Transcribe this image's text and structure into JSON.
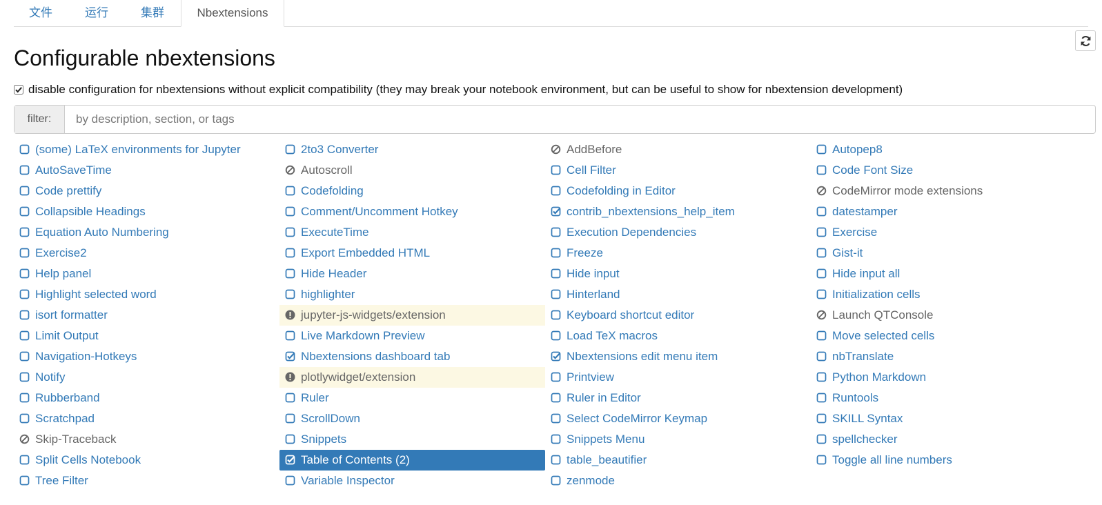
{
  "tabs": [
    "文件",
    "运行",
    "集群",
    "Nbextensions"
  ],
  "active_tab": 3,
  "page_title": "Configurable nbextensions",
  "compat_label": "disable configuration for nbextensions without explicit compatibility (they may break your notebook environment, but can be useful to show for nbextension development)",
  "compat_checked": true,
  "filter": {
    "label": "filter:",
    "placeholder": "by description, section, or tags",
    "value": ""
  },
  "icons": {
    "refresh": "refresh-icon",
    "unchecked": "square-icon",
    "checked": "check-square-icon",
    "disabled": "ban-icon",
    "warning": "exclamation-circle-icon"
  },
  "colors": {
    "link": "#337ab7",
    "selected_bg": "#337ab7",
    "warning_bg": "#fcf8e3",
    "muted": "#666666"
  },
  "extensions": [
    {
      "label": "(some) LaTeX environments for Jupyter",
      "state": "unchecked"
    },
    {
      "label": "2to3 Converter",
      "state": "unchecked"
    },
    {
      "label": "AddBefore",
      "state": "disabled"
    },
    {
      "label": "Autopep8",
      "state": "unchecked"
    },
    {
      "label": "AutoSaveTime",
      "state": "unchecked"
    },
    {
      "label": "Autoscroll",
      "state": "disabled"
    },
    {
      "label": "Cell Filter",
      "state": "unchecked"
    },
    {
      "label": "Code Font Size",
      "state": "unchecked"
    },
    {
      "label": "Code prettify",
      "state": "unchecked"
    },
    {
      "label": "Codefolding",
      "state": "unchecked"
    },
    {
      "label": "Codefolding in Editor",
      "state": "unchecked"
    },
    {
      "label": "CodeMirror mode extensions",
      "state": "disabled"
    },
    {
      "label": "Collapsible Headings",
      "state": "unchecked"
    },
    {
      "label": "Comment/Uncomment Hotkey",
      "state": "unchecked"
    },
    {
      "label": "contrib_nbextensions_help_item",
      "state": "checked"
    },
    {
      "label": "datestamper",
      "state": "unchecked"
    },
    {
      "label": "Equation Auto Numbering",
      "state": "unchecked"
    },
    {
      "label": "ExecuteTime",
      "state": "unchecked"
    },
    {
      "label": "Execution Dependencies",
      "state": "unchecked"
    },
    {
      "label": "Exercise",
      "state": "unchecked"
    },
    {
      "label": "Exercise2",
      "state": "unchecked"
    },
    {
      "label": "Export Embedded HTML",
      "state": "unchecked"
    },
    {
      "label": "Freeze",
      "state": "unchecked"
    },
    {
      "label": "Gist-it",
      "state": "unchecked"
    },
    {
      "label": "Help panel",
      "state": "unchecked"
    },
    {
      "label": "Hide Header",
      "state": "unchecked"
    },
    {
      "label": "Hide input",
      "state": "unchecked"
    },
    {
      "label": "Hide input all",
      "state": "unchecked"
    },
    {
      "label": "Highlight selected word",
      "state": "unchecked"
    },
    {
      "label": "highlighter",
      "state": "unchecked"
    },
    {
      "label": "Hinterland",
      "state": "unchecked"
    },
    {
      "label": "Initialization cells",
      "state": "unchecked"
    },
    {
      "label": "isort formatter",
      "state": "unchecked"
    },
    {
      "label": "jupyter-js-widgets/extension",
      "state": "warning"
    },
    {
      "label": "Keyboard shortcut editor",
      "state": "unchecked"
    },
    {
      "label": "Launch QTConsole",
      "state": "disabled"
    },
    {
      "label": "Limit Output",
      "state": "unchecked"
    },
    {
      "label": "Live Markdown Preview",
      "state": "unchecked"
    },
    {
      "label": "Load TeX macros",
      "state": "unchecked"
    },
    {
      "label": "Move selected cells",
      "state": "unchecked"
    },
    {
      "label": "Navigation-Hotkeys",
      "state": "unchecked"
    },
    {
      "label": "Nbextensions dashboard tab",
      "state": "checked"
    },
    {
      "label": "Nbextensions edit menu item",
      "state": "checked"
    },
    {
      "label": "nbTranslate",
      "state": "unchecked"
    },
    {
      "label": "Notify",
      "state": "unchecked"
    },
    {
      "label": "plotlywidget/extension",
      "state": "warning"
    },
    {
      "label": "Printview",
      "state": "unchecked"
    },
    {
      "label": "Python Markdown",
      "state": "unchecked"
    },
    {
      "label": "Rubberband",
      "state": "unchecked"
    },
    {
      "label": "Ruler",
      "state": "unchecked"
    },
    {
      "label": "Ruler in Editor",
      "state": "unchecked"
    },
    {
      "label": "Runtools",
      "state": "unchecked"
    },
    {
      "label": "Scratchpad",
      "state": "unchecked"
    },
    {
      "label": "ScrollDown",
      "state": "unchecked"
    },
    {
      "label": "Select CodeMirror Keymap",
      "state": "unchecked"
    },
    {
      "label": "SKILL Syntax",
      "state": "unchecked"
    },
    {
      "label": "Skip-Traceback",
      "state": "disabled"
    },
    {
      "label": "Snippets",
      "state": "unchecked"
    },
    {
      "label": "Snippets Menu",
      "state": "unchecked"
    },
    {
      "label": "spellchecker",
      "state": "unchecked"
    },
    {
      "label": "Split Cells Notebook",
      "state": "unchecked"
    },
    {
      "label": "Table of Contents (2)",
      "state": "selected"
    },
    {
      "label": "table_beautifier",
      "state": "unchecked"
    },
    {
      "label": "Toggle all line numbers",
      "state": "unchecked"
    },
    {
      "label": "Tree Filter",
      "state": "unchecked"
    },
    {
      "label": "Variable Inspector",
      "state": "unchecked"
    },
    {
      "label": "zenmode",
      "state": "unchecked"
    }
  ]
}
